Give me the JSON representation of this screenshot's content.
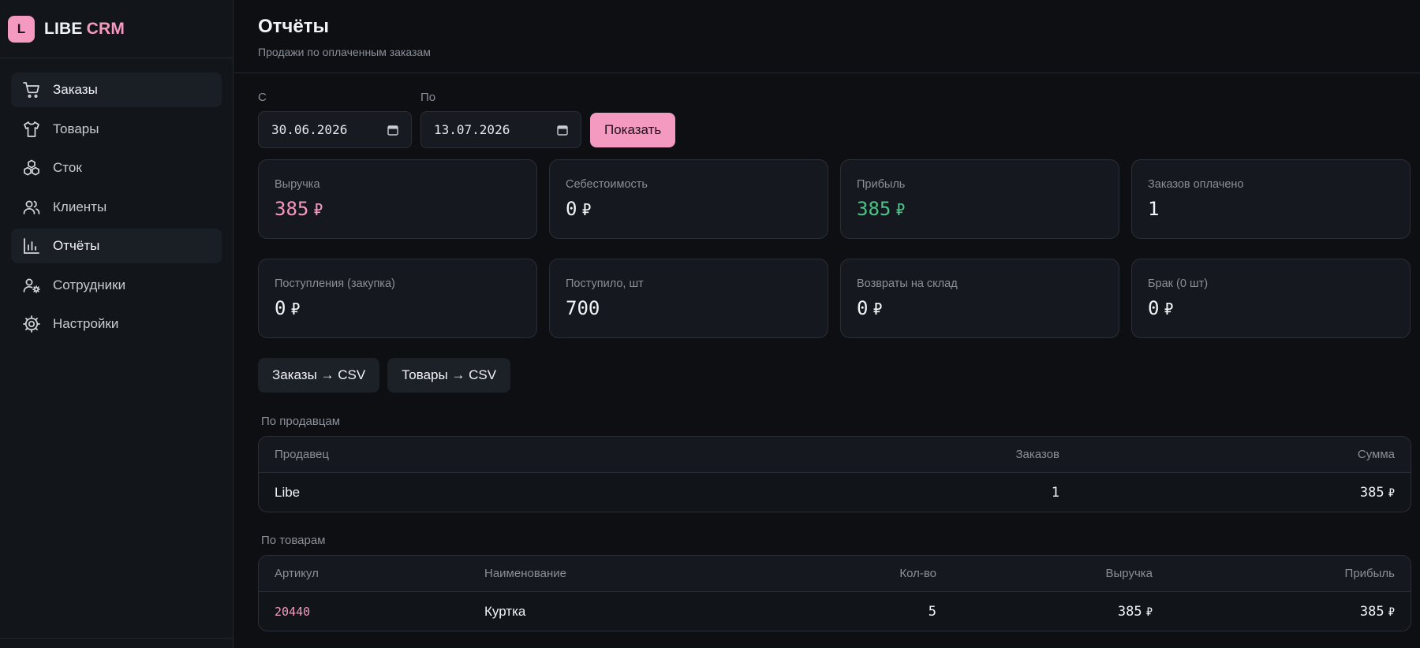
{
  "brand": {
    "logo_letter": "L",
    "name": "LIBE",
    "suffix": "CRM"
  },
  "nav": [
    {
      "label": "Заказы",
      "icon": "cart-icon",
      "active": true
    },
    {
      "label": "Товары",
      "icon": "shirt-icon",
      "active": false
    },
    {
      "label": "Сток",
      "icon": "boxes-icon",
      "active": false
    },
    {
      "label": "Клиенты",
      "icon": "users-icon",
      "active": false
    },
    {
      "label": "Отчёты",
      "icon": "bar-chart-icon",
      "active": true
    },
    {
      "label": "Сотрудники",
      "icon": "user-cog-icon",
      "active": false
    },
    {
      "label": "Настройки",
      "icon": "gear-icon",
      "active": false
    }
  ],
  "header": {
    "title": "Отчёты",
    "subtitle": "Продажи по оплаченным заказам"
  },
  "filters": {
    "from_label": "С",
    "from_value": "30.06.2026",
    "to_label": "По",
    "to_value": "13.07.2026",
    "show_label": "Показать"
  },
  "currency": "₽",
  "cards": [
    {
      "label": "Выручка",
      "value": "385",
      "currency": true,
      "accent": "#f49ac1"
    },
    {
      "label": "Себестоимость",
      "value": "0",
      "currency": true,
      "accent": ""
    },
    {
      "label": "Прибыль",
      "value": "385",
      "currency": true,
      "accent": "#4cc38a"
    },
    {
      "label": "Заказов оплачено",
      "value": "1",
      "currency": false,
      "accent": ""
    },
    {
      "label": "Поступления (закупка)",
      "value": "0",
      "currency": true,
      "accent": ""
    },
    {
      "label": "Поступило, шт",
      "value": "700",
      "currency": false,
      "accent": ""
    },
    {
      "label": "Возвраты на склад",
      "value": "0",
      "currency": true,
      "accent": ""
    },
    {
      "label": "Брак (0 шт)",
      "value": "0",
      "currency": true,
      "accent": ""
    }
  ],
  "exports": {
    "orders_csv": "Заказы → CSV",
    "products_csv": "Товары → CSV"
  },
  "sellers": {
    "title": "По продавцам",
    "headers": [
      "Продавец",
      "Заказов",
      "Сумма"
    ],
    "rows": [
      {
        "seller": "Libe",
        "orders": "1",
        "sum": "385"
      }
    ]
  },
  "products": {
    "title": "По товарам",
    "headers": [
      "Артикул",
      "Наименование",
      "Кол-во",
      "Выручка",
      "Прибыль"
    ],
    "rows": [
      {
        "sku": "20440",
        "name": "Куртка",
        "qty": "5",
        "revenue": "385",
        "profit": "385"
      }
    ]
  }
}
